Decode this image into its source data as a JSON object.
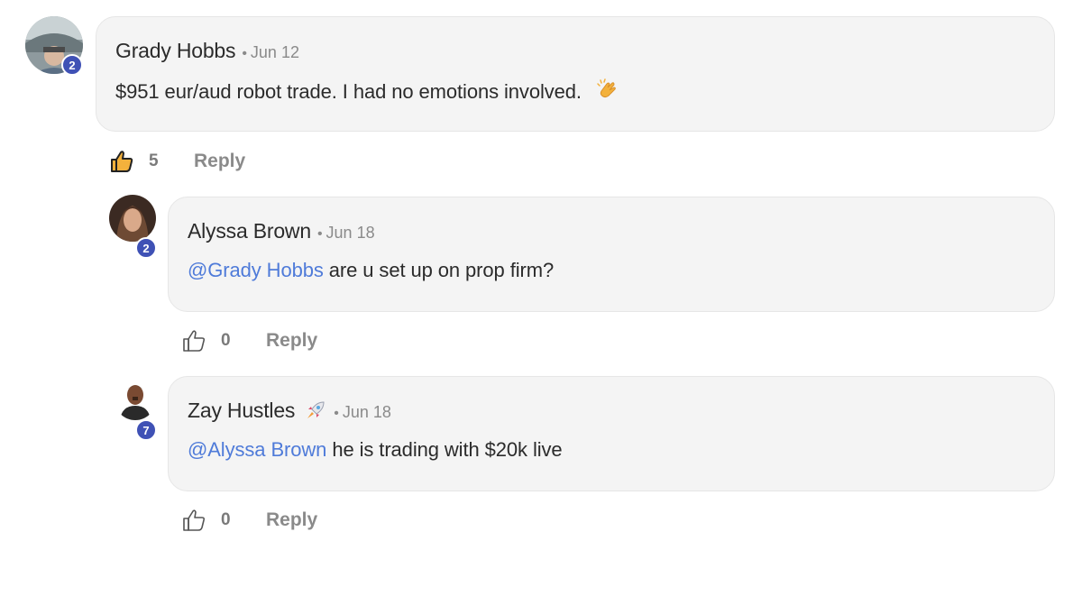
{
  "comments": [
    {
      "author": "Grady Hobbs",
      "separator": "•",
      "date": "Jun 12",
      "level": "2",
      "text": "$951 eur/aud robot trade. I had no emotions involved.",
      "emoji": "clapping-hands-icon",
      "likes": "5",
      "liked": true,
      "reply_label": "Reply"
    },
    {
      "author": "Alyssa Brown",
      "separator": "•",
      "date": "Jun 18",
      "level": "2",
      "mention": "@Grady Hobbs",
      "text": " are u set up on prop firm?",
      "likes": "0",
      "liked": false,
      "reply_label": "Reply"
    },
    {
      "author": "Zay Hustles",
      "author_emoji": "rocket-icon",
      "separator": "•",
      "date": "Jun 18",
      "level": "7",
      "mention": "@Alyssa Brown",
      "text": " he is trading with $20k live",
      "likes": "0",
      "liked": false,
      "reply_label": "Reply"
    }
  ],
  "colors": {
    "mention": "#4f7bd9",
    "badge": "#3f51b5",
    "bubble": "#f4f4f4"
  }
}
